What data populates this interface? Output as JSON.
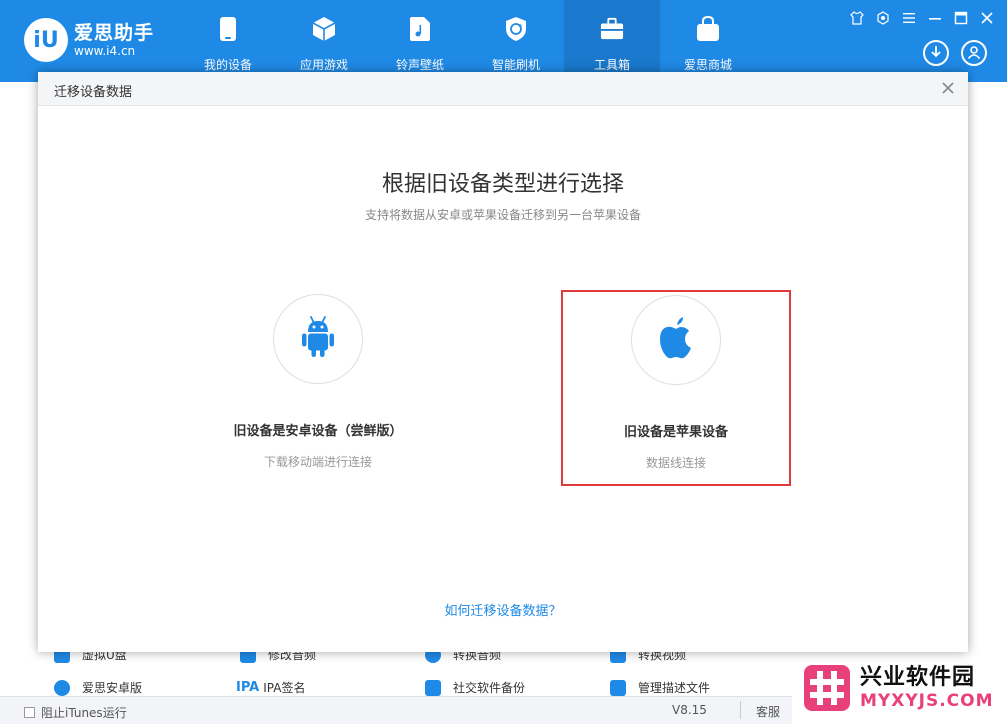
{
  "app": {
    "name": "爱思助手",
    "url": "www.i4.cn",
    "logo_glyph": "iU"
  },
  "nav": [
    {
      "label": "我的设备",
      "icon": "phone-icon"
    },
    {
      "label": "应用游戏",
      "icon": "cube-icon"
    },
    {
      "label": "铃声壁纸",
      "icon": "music-file-icon"
    },
    {
      "label": "智能刷机",
      "icon": "refresh-shield-icon"
    },
    {
      "label": "工具箱",
      "icon": "toolbox-icon",
      "active": true
    },
    {
      "label": "爱思商城",
      "icon": "shopping-bag-icon"
    }
  ],
  "background_tools": [
    {
      "label": "虚拟U盘"
    },
    {
      "label": "修改音频"
    },
    {
      "label": "转换音频"
    },
    {
      "label": "转换视频"
    },
    {
      "label": "爱思安卓版"
    },
    {
      "label": "IPA签名",
      "prefix": "IPA"
    },
    {
      "label": "社交软件备份"
    },
    {
      "label": "管理描述文件"
    }
  ],
  "bottom": {
    "itunes_label": "阻止iTunes运行",
    "version": "V8.15",
    "service": "客服"
  },
  "modal": {
    "title": "迁移设备数据",
    "heading": "根据旧设备类型进行选择",
    "subheading": "支持将数据从安卓或苹果设备迁移到另一台苹果设备",
    "options": [
      {
        "title": "旧设备是安卓设备（尝鲜版）",
        "subtitle": "下载移动端进行连接",
        "icon": "android-icon"
      },
      {
        "title": "旧设备是苹果设备",
        "subtitle": "数据线连接",
        "icon": "apple-icon",
        "highlighted": true
      }
    ],
    "help_link": "如何迁移设备数据？"
  },
  "watermark": {
    "cn": "兴业软件园",
    "en": "MYXYJS.COM"
  },
  "colors": {
    "brand_blue": "#1f8ae6",
    "highlight_red": "#e03a3a",
    "watermark_pink": "#e8407a"
  }
}
